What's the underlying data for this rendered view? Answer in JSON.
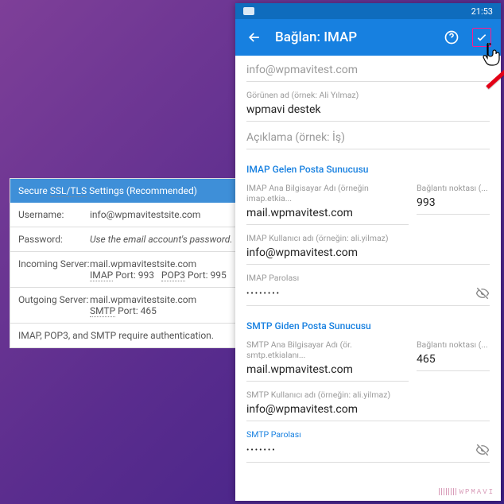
{
  "settings": {
    "header": "Secure SSL/TLS Settings (Recommended)",
    "rows": {
      "username_label": "Username:",
      "username_value": "info@wpmavitestsite.com",
      "password_label": "Password:",
      "password_value": "Use the email account's password.",
      "incoming_label": "Incoming Server:",
      "incoming_host": "mail.wpmavitestsite.com",
      "incoming_ports": "IMAP Port: 993   POP3 Port: 995",
      "outgoing_label": "Outgoing Server:",
      "outgoing_host": "mail.wpmavitestsite.com",
      "outgoing_ports": "SMTP Port: 465"
    },
    "footer": "IMAP, POP3, and SMTP require authentication."
  },
  "phone": {
    "time": "21:53",
    "title": "Bağlan: IMAP",
    "email_gray": "info@wpmavitest.com",
    "displayname_label": "Görünen ad (örnek: Ali Yılmaz)",
    "displayname_value": "wpmavi destek",
    "description_placeholder": "Açıklama (örnek: İş)",
    "imap": {
      "section": "IMAP Gelen Posta Sunucusu",
      "host_label": "IMAP Ana Bilgisayar Adı (örneğin imap.etkia...",
      "host_value": "mail.wpmavitest.com",
      "port_label": "Bağlantı noktası (...",
      "port_value": "993",
      "user_label": "IMAP Kullanıcı adı (örneğin: ali.yilmaz)",
      "user_value": "info@wpmavitest.com",
      "pw_label": "IMAP Parolası",
      "pw_value": "••••••••"
    },
    "smtp": {
      "section": "SMTP Giden Posta Sunucusu",
      "host_label": "SMTP Ana Bilgisayar Adı (ör. smtp.etkialanı...",
      "host_value": "mail.wpmavitest.com",
      "port_label": "Bağlantı noktası (...",
      "port_value": "465",
      "user_label": "SMTP Kullanıcı adı (örneğin: ali.yilmaz)",
      "user_value": "info@wpmavitest.com",
      "pw_label": "SMTP Parolası",
      "pw_value": "•••••••"
    }
  },
  "watermark": "WPMAVI"
}
